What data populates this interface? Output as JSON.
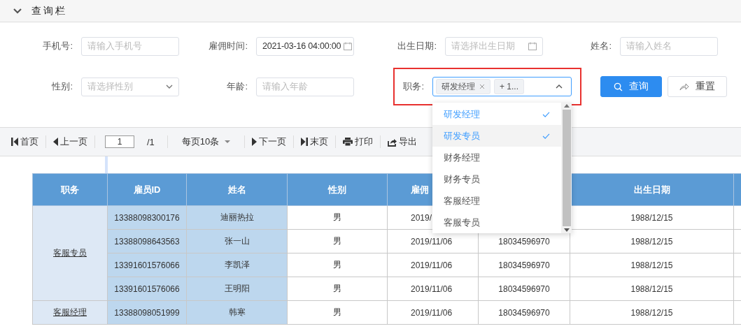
{
  "panel": {
    "title": "查询栏",
    "expanded": true
  },
  "form_rows": [
    {
      "fields": [
        {
          "kind": "text",
          "label": "手机号:",
          "placeholder": "请输入手机号"
        },
        {
          "kind": "date",
          "label": "雇佣时间:",
          "value": "2021-03-16 04:00:00"
        },
        {
          "kind": "date",
          "label": "出生日期:",
          "placeholder": "请选择出生日期"
        },
        {
          "kind": "text",
          "label": "姓名:",
          "placeholder": "请输入姓名"
        }
      ]
    },
    {
      "fields": [
        {
          "kind": "select",
          "label": "性别:",
          "placeholder": "请选择性别"
        },
        {
          "kind": "text",
          "label": "年龄:",
          "placeholder": "请输入年龄"
        },
        {
          "kind": "multiselect",
          "label": "职务:",
          "highlighted": true,
          "tags": [
            "研发经理"
          ],
          "more": "+ 1...",
          "expanded": true
        }
      ]
    }
  ],
  "buttons": [
    {
      "kind": "primary",
      "label": "查询"
    },
    {
      "kind": "default",
      "label": "重置"
    }
  ],
  "dropdown_options": [
    {
      "label": "研发经理",
      "selected": true,
      "hovered": false
    },
    {
      "label": "研发专员",
      "selected": true,
      "hovered": true
    },
    {
      "label": "财务经理",
      "selected": false,
      "hovered": false
    },
    {
      "label": "财务专员",
      "selected": false,
      "hovered": false
    },
    {
      "label": "客服经理",
      "selected": false,
      "hovered": false
    },
    {
      "label": "客服专员",
      "selected": false,
      "hovered": false
    }
  ],
  "toolbar": {
    "first": "首页",
    "prev": "上一页",
    "page": "1",
    "total": "/1",
    "page_size": "每页10条",
    "next": "下一页",
    "last": "末页",
    "print": "打印",
    "export": "导出"
  },
  "table": {
    "columns": [
      {
        "label": "职务"
      },
      {
        "label": "雇员ID"
      },
      {
        "label": "姓名"
      },
      {
        "label": "性别"
      },
      {
        "label": "雇佣"
      },
      {},
      {
        "label": "出生日期"
      },
      {}
    ],
    "groups": [
      {
        "job": "客服专员",
        "rows": [
          {
            "id": "13388098300176",
            "name": "迪丽热拉",
            "gender": "男",
            "hired": "2019/",
            "birth": "1988/12/15"
          },
          {
            "id": "13388098643563",
            "name": "张一山",
            "gender": "男",
            "hired": "2019/11/06",
            "phone": "18034596970",
            "birth": "1988/12/15"
          },
          {
            "id": "13391601576066",
            "name": "李凯泽",
            "gender": "男",
            "hired": "2019/11/06",
            "phone": "18034596970",
            "birth": "1988/12/15"
          },
          {
            "id": "13391601576066",
            "name": "王明阳",
            "gender": "男",
            "hired": "2019/11/06",
            "phone": "18034596970",
            "birth": "1988/12/15"
          }
        ]
      },
      {
        "job": "客服经理",
        "rows": [
          {
            "id": "13388098051999",
            "name": "韩寒",
            "gender": "男",
            "hired": "2019/11/06",
            "phone": "18034596970",
            "birth": "1988/12/15"
          }
        ]
      }
    ]
  }
}
